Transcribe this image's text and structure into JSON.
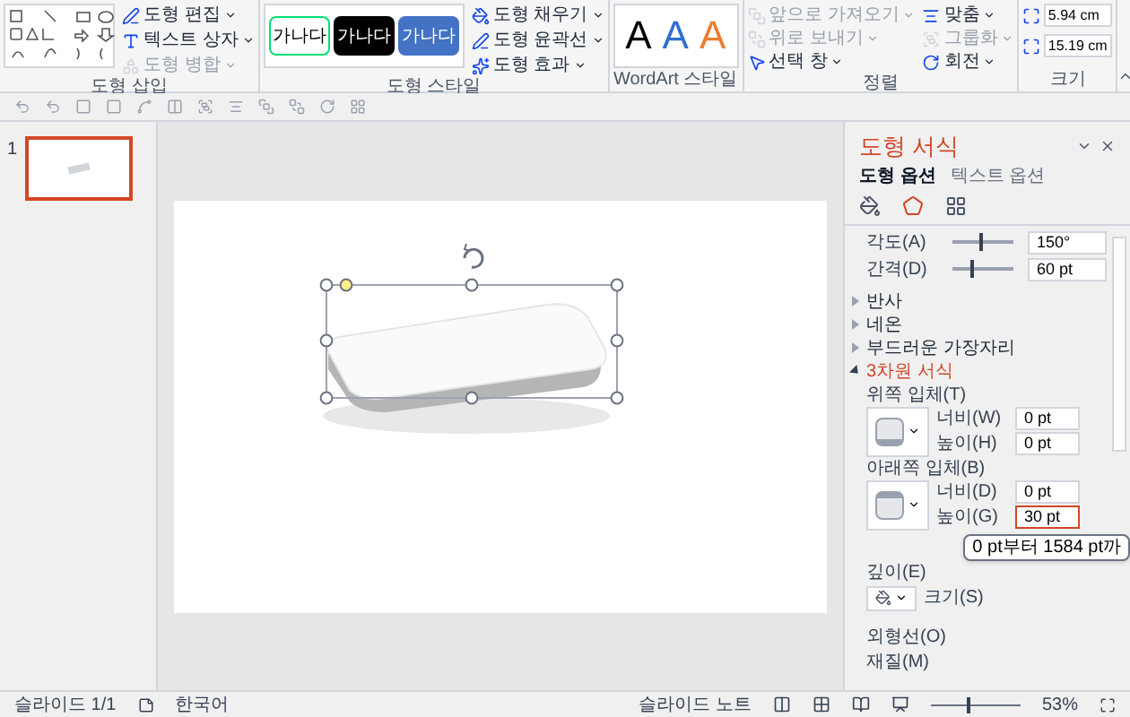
{
  "ribbon": {
    "groups": [
      {
        "kind": "shapes",
        "label": "도형 삽입",
        "commands": [
          {
            "label": "도형 편집",
            "disabled": false
          },
          {
            "label": "텍스트 상자",
            "disabled": false
          },
          {
            "label": "도형 병합",
            "disabled": true
          }
        ]
      },
      {
        "kind": "styles",
        "label": "도형 스타일",
        "swatches": [
          {
            "text": "가나다",
            "color": "#ffffff"
          },
          {
            "text": "가나다",
            "color": "#000000"
          },
          {
            "text": "가나다",
            "color": "#4472c4"
          }
        ],
        "commands": [
          {
            "label": "도형 채우기",
            "disabled": false
          },
          {
            "label": "도형 윤곽선",
            "disabled": false
          },
          {
            "label": "도형 효과",
            "disabled": false
          }
        ]
      },
      {
        "kind": "wordart",
        "label": "WordArt 스타일",
        "letters": [
          {
            "text": "A",
            "color": "#000000"
          },
          {
            "text": "A",
            "color": "#2f6fd0"
          },
          {
            "text": "A",
            "color": "#ed7d31"
          }
        ]
      },
      {
        "kind": "arrange",
        "label": "정렬",
        "commands": [
          {
            "label": "앞으로 가져오기",
            "disabled": true
          },
          {
            "label": "위로 보내기",
            "disabled": true
          },
          {
            "label": "선택 창",
            "disabled": false
          },
          {
            "label": "맞춤",
            "disabled": false
          },
          {
            "label": "그룹화",
            "disabled": true
          },
          {
            "label": "회전",
            "disabled": false
          }
        ]
      },
      {
        "kind": "size",
        "label": "크기",
        "fields": [
          {
            "value": "5.94 cm"
          },
          {
            "value": "15.19 cm"
          }
        ]
      }
    ]
  },
  "thumbnails": [
    {
      "number": "1",
      "selected": true
    }
  ],
  "format_pane": {
    "title": "도형 서식",
    "tabs": [
      {
        "label": "도형 옵션",
        "selected": true
      },
      {
        "label": "텍스트 옵션",
        "selected": false
      }
    ],
    "icons": [
      {
        "kind": "fill",
        "selected": false
      },
      {
        "kind": "effects",
        "selected": true
      },
      {
        "kind": "size",
        "selected": false
      }
    ],
    "sliders": [
      {
        "label": "각도(A)",
        "level": 0.45,
        "value": "150°"
      },
      {
        "label": "간격(D)",
        "level": 0.3,
        "value": "60 pt"
      }
    ],
    "sections": [
      {
        "label": "반사",
        "expanded": false
      },
      {
        "label": "네온",
        "expanded": false
      },
      {
        "label": "부드러운 가장자리",
        "expanded": false
      },
      {
        "label": "3차원 서식",
        "expanded": true
      }
    ],
    "bevels": [
      {
        "label": "위쪽 입체(T)",
        "fields": [
          {
            "label": "너비(W)",
            "value": "0 pt",
            "focused": false
          },
          {
            "label": "높이(H)",
            "value": "0 pt",
            "focused": false
          }
        ]
      },
      {
        "label": "아래쪽 입체(B)",
        "fields": [
          {
            "label": "너비(D)",
            "value": "0 pt",
            "focused": false
          },
          {
            "label": "높이(G)",
            "value": "30 pt",
            "focused": true
          }
        ]
      }
    ],
    "tooltip": "0 pt부터 1584 pt까",
    "depth": {
      "label": "깊이(E)",
      "size_label": "크기(S)"
    },
    "contour": {
      "label": "외형선(O)"
    },
    "material": {
      "label": "재질(M)"
    }
  },
  "status_bar": {
    "slide": "슬라이드 1/1",
    "language": "한국어",
    "notes": "슬라이드 노트",
    "zoom": {
      "level": 0.4,
      "value": "53%"
    }
  }
}
